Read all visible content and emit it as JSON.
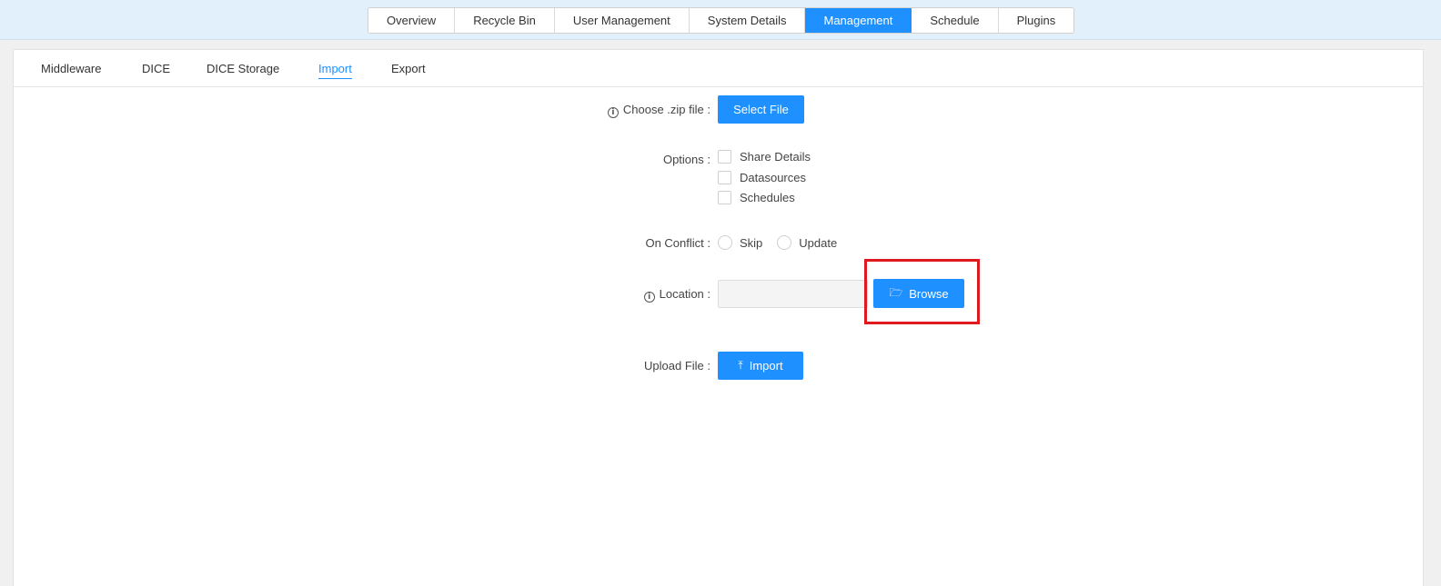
{
  "top_tabs": [
    {
      "label": "Overview"
    },
    {
      "label": "Recycle Bin"
    },
    {
      "label": "User Management"
    },
    {
      "label": "System Details"
    },
    {
      "label": "Management",
      "active": true
    },
    {
      "label": "Schedule"
    },
    {
      "label": "Plugins"
    }
  ],
  "sub_tabs": [
    {
      "label": "Middleware"
    },
    {
      "label": "DICE"
    },
    {
      "label": "DICE Storage"
    },
    {
      "label": "Import",
      "active": true
    },
    {
      "label": "Export"
    }
  ],
  "form": {
    "zip_label": "Choose .zip file :",
    "select_file_label": "Select File",
    "options_label": "Options :",
    "options": [
      "Share Details",
      "Datasources",
      "Schedules"
    ],
    "conflict_label": "On Conflict :",
    "conflict_options": [
      "Skip",
      "Update"
    ],
    "location_label": "Location :",
    "location_value": "",
    "browse_label": "Browse",
    "upload_label": "Upload File :",
    "import_label": "Import"
  },
  "icons": {
    "info": "info-circle-icon",
    "browse": "folder-open-icon",
    "import": "upload-icon"
  },
  "colors": {
    "accent": "#1e90ff",
    "highlight": "#e0191e",
    "topbar": "#e1f0fa"
  }
}
